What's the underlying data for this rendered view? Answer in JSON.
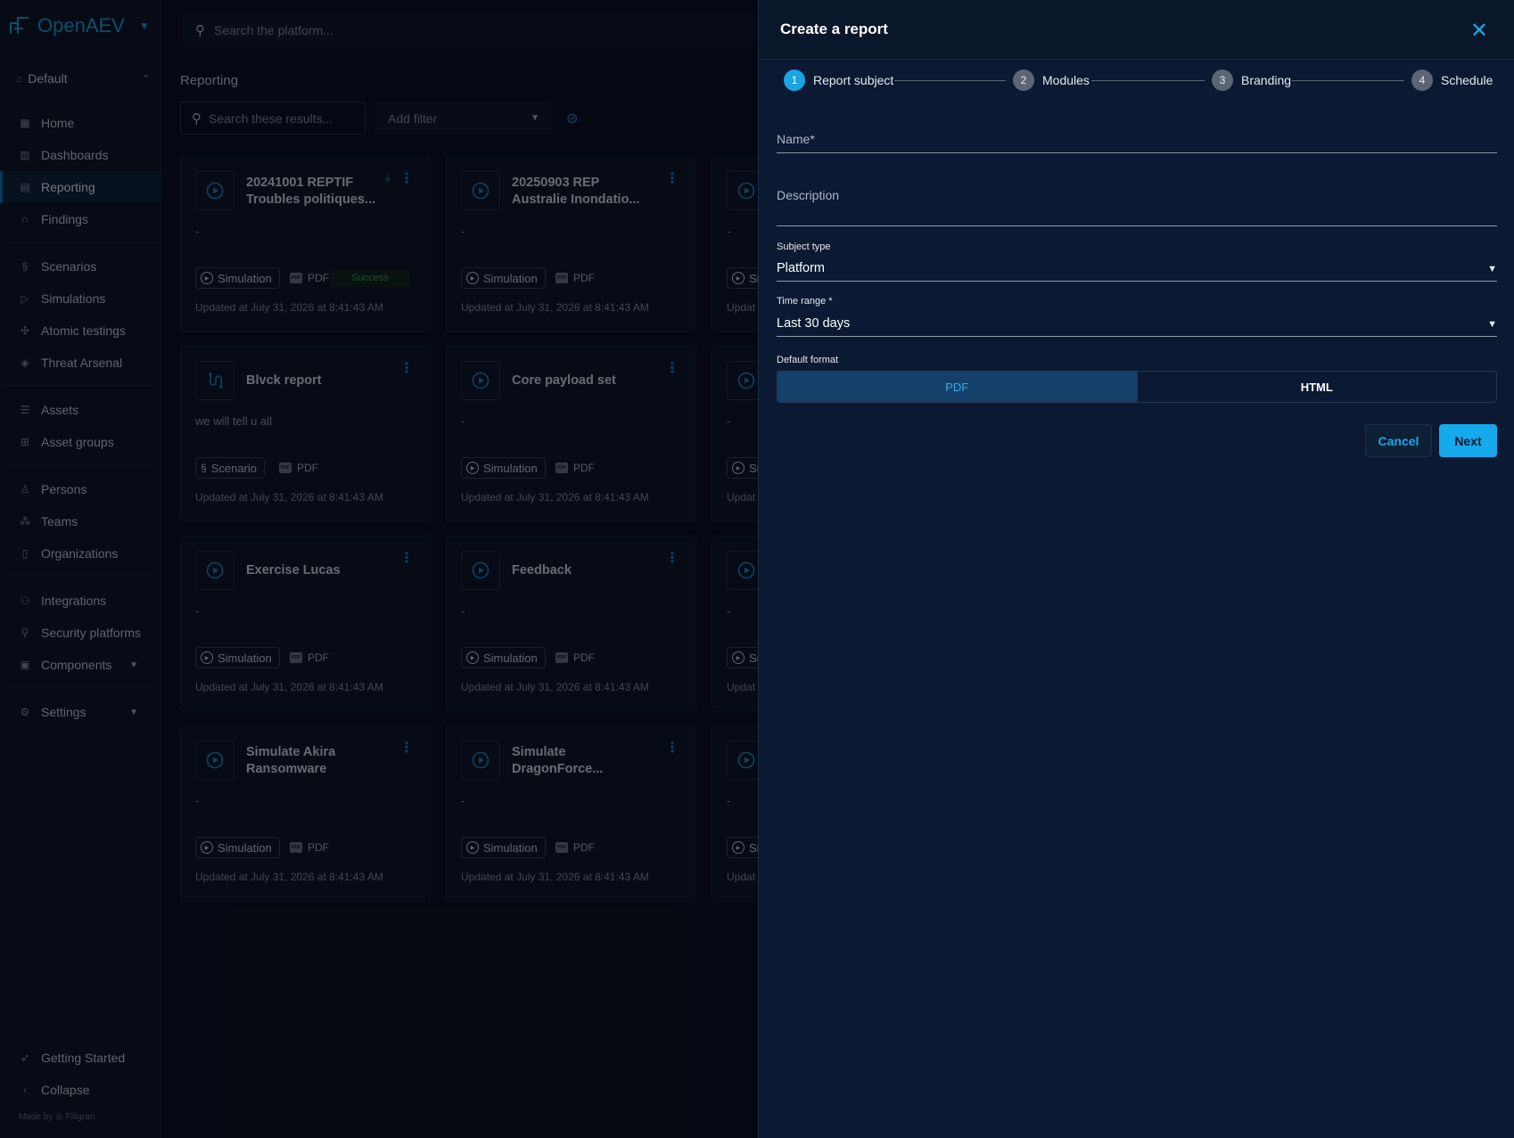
{
  "app": {
    "name": "OpenAEV"
  },
  "workspace": {
    "label": "Default"
  },
  "topbar": {
    "search_placeholder": "Search the platform..."
  },
  "sidebar": {
    "items": [
      {
        "label": "Home",
        "icon": "home-icon"
      },
      {
        "label": "Dashboards",
        "icon": "dashboard-icon"
      },
      {
        "label": "Reporting",
        "icon": "report-icon",
        "active": true
      },
      {
        "label": "Findings",
        "icon": "binoculars-icon"
      },
      {
        "label": "Scenarios",
        "icon": "scenario-icon"
      },
      {
        "label": "Simulations",
        "icon": "play-icon"
      },
      {
        "label": "Atomic testings",
        "icon": "atom-icon"
      },
      {
        "label": "Threat Arsenal",
        "icon": "arsenal-icon"
      },
      {
        "label": "Assets",
        "icon": "assets-icon"
      },
      {
        "label": "Asset groups",
        "icon": "asset-groups-icon"
      },
      {
        "label": "Persons",
        "icon": "person-icon"
      },
      {
        "label": "Teams",
        "icon": "teams-icon"
      },
      {
        "label": "Organizations",
        "icon": "organization-icon"
      },
      {
        "label": "Integrations",
        "icon": "integrations-icon"
      },
      {
        "label": "Security platforms",
        "icon": "security-platform-icon"
      },
      {
        "label": "Components",
        "icon": "components-icon"
      },
      {
        "label": "Settings",
        "icon": "settings-icon"
      }
    ],
    "getting_started": "Getting Started",
    "collapse": "Collapse",
    "made_by": "Made by",
    "made_by_brand": "Filigran"
  },
  "main": {
    "title": "Reporting",
    "search_placeholder": "Search these results...",
    "filter_placeholder": "Add filter",
    "cards": [
      {
        "title": "20241001 REPTIF Troubles politiques...",
        "desc": "-",
        "type": "Simulation",
        "format": "PDF",
        "status": "Success",
        "updated": "Updated at July 31, 2026 at 8:41:43 AM"
      },
      {
        "title": "20250903 REP Australie Inondatio...",
        "desc": "-",
        "type": "Simulation",
        "format": "PDF",
        "updated": "Updated at July 31, 2026 at 8:41:43 AM"
      },
      {
        "title": "Blvck report",
        "desc": "we will tell u all",
        "type": "Scenario",
        "format": "PDF",
        "updated": "Updated at July 31, 2026 at 8:41:43 AM"
      },
      {
        "title": "Core payload set",
        "desc": "-",
        "type": "Simulation",
        "format": "PDF",
        "updated": "Updated at July 31, 2026 at 8:41:43 AM"
      },
      {
        "title": "Exercise Lucas",
        "desc": "-",
        "type": "Simulation",
        "format": "PDF",
        "updated": "Updated at July 31, 2026 at 8:41:43 AM"
      },
      {
        "title": "Feedback",
        "desc": "-",
        "type": "Simulation",
        "format": "PDF",
        "updated": "Updated at July 31, 2026 at 8:41:43 AM"
      },
      {
        "title": "Simulate Akira Ransomware",
        "desc": "-",
        "type": "Simulation",
        "format": "PDF",
        "updated": "Updated at July 31, 2026 at 8:41:43 AM"
      },
      {
        "title": "Simulate DragonForce...",
        "desc": "-",
        "type": "Simulation",
        "format": "PDF",
        "updated": "Updated at July 31, 2026 at 8:41:43 AM"
      }
    ],
    "partial_cards": {
      "desc": "-",
      "type": "Si",
      "updated": "Updat"
    }
  },
  "drawer": {
    "title": "Create a report",
    "steps": [
      {
        "num": "1",
        "label": "Report subject"
      },
      {
        "num": "2",
        "label": "Modules"
      },
      {
        "num": "3",
        "label": "Branding"
      },
      {
        "num": "4",
        "label": "Schedule"
      }
    ],
    "name_label": "Name*",
    "description_label": "Description",
    "subject_type_label": "Subject type",
    "subject_type_value": "Platform",
    "time_range_label": "Time range *",
    "time_range_value": "Last 30 days",
    "default_format_label": "Default format",
    "format_options": [
      "PDF",
      "HTML"
    ],
    "cancel_label": "Cancel",
    "next_label": "Next"
  },
  "colors": {
    "accent": "#16a9ec",
    "background": "#070d19",
    "drawer": "#0b1a32"
  }
}
